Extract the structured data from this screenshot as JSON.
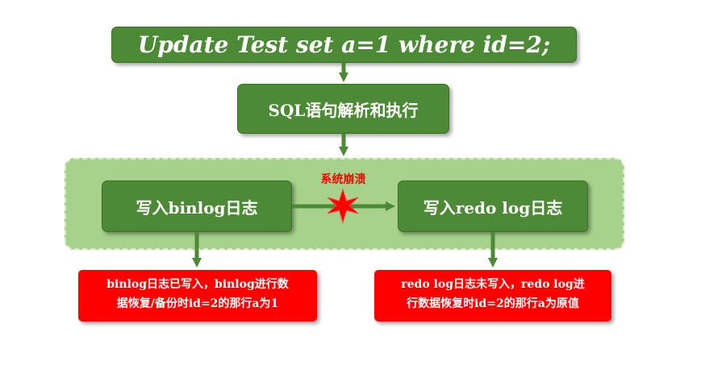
{
  "diagram": {
    "sql_statement": "Update Test set a=1 where id=2;",
    "parse_step": "SQL语句解析和执行",
    "binlog_step": "写入binlog日志",
    "redo_step": "写入redo log日志",
    "crash_label": "系统崩溃",
    "binlog_note": {
      "line1": "binlog日志已写入，binlog进行数",
      "line2": "据恢复/备份时id=2的那行a为1"
    },
    "redo_note": {
      "line1": "redo log日志未写入，redo log进",
      "line2": "行数据恢复时id=2的那行a为原值"
    }
  },
  "colors": {
    "box_green": "#4d8a35",
    "area_green": "#a7d28b",
    "alert_red": "#ff0000",
    "arrow": "#4d8a35"
  }
}
